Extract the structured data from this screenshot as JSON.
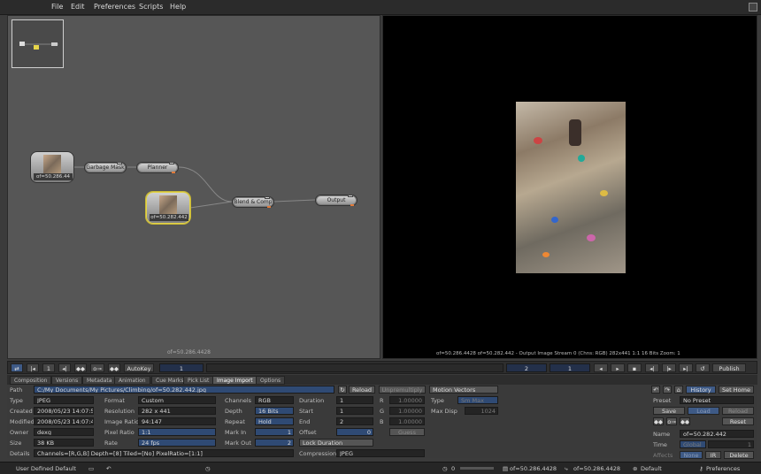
{
  "menu": {
    "file": "File",
    "edit": "Edit",
    "preferences": "Preferences",
    "scripts": "Scripts",
    "help": "Help"
  },
  "graph": {
    "label": "of=50.286.4428",
    "nodes": {
      "read1": "of=50.286.44",
      "garbage": "Garbage Mask",
      "planner": "Planner",
      "read2": "of=50.282.442",
      "blend": "Blend & Comp",
      "output": "Output"
    }
  },
  "viewer": {
    "status": "of=50.286.4428  of=50.282.442 - Output Image  Stream 0 (Chns: RGB)  282x441  1:1  16 Bits  Zoom: 1"
  },
  "toolbar": {
    "autokey": "AutoKey",
    "frame1": "1",
    "frame2": "1",
    "frame_field": "1",
    "frame_a": "2",
    "frame_b": "1",
    "publish": "Publish"
  },
  "tabs": [
    "Composition",
    "Versions",
    "Metadata",
    "Animation",
    "Cue Marks",
    "Pick List",
    "Image Import",
    "Options"
  ],
  "fields": {
    "path_label": "Path",
    "path": "C:/My Documents/My Pictures/Climbing/of=50.282.442.jpg",
    "reload": "Reload",
    "unpremultiply": "Unpremultiply",
    "motion_vectors": "Motion Vectors",
    "type_label": "Type",
    "type": "JPEG",
    "format_label": "Format",
    "format": "Custom",
    "channels_label": "Channels",
    "channels": "RGB",
    "duration_label": "Duration",
    "duration": "1",
    "r_label": "R",
    "r": "1.00000",
    "mv_type_label": "Type",
    "mv_type": "Sm Max",
    "created_label": "Created",
    "created": "2008/05/23 14:07:50",
    "resolution_label": "Resolution",
    "resolution": "282 x 441",
    "depth_label": "Depth",
    "depth": "16 Bits",
    "start_label": "Start",
    "start": "1",
    "g_label": "G",
    "g": "1.00000",
    "maxdisp_label": "Max Disp",
    "maxdisp": "1024",
    "modified_label": "Modified",
    "modified": "2008/05/23 14:07:47",
    "imageratio_label": "Image Ratio",
    "imageratio": "94:147",
    "repeat_label": "Repeat",
    "repeat": "Hold",
    "end_label": "End",
    "end": "2",
    "b_label": "B",
    "b": "1.00000",
    "owner_label": "Owner",
    "owner": "dexg",
    "pixelratio_label": "Pixel Ratio",
    "pixelratio": "1:1",
    "markin_label": "Mark In",
    "markin": "1",
    "offset_label": "Offset",
    "offset": "0",
    "guess": "Guess",
    "size_label": "Size",
    "size": "38 KB",
    "rate_label": "Rate",
    "rate": "24 fps",
    "markout_label": "Mark Out",
    "markout": "2",
    "lock_duration": "Lock Duration",
    "details_label": "Details",
    "details": "Channels=[R,G,B] Depth=[8] Tiled=[No] PixelRatio=[1:1]",
    "compression_label": "Compression",
    "compression": "JPEG"
  },
  "right": {
    "history": "History",
    "sethome": "Set Home",
    "preset_label": "Preset",
    "preset": "No Preset",
    "save": "Save",
    "load": "Load",
    "reload": "Reload",
    "reset": "Reset",
    "name_label": "Name",
    "name": "of=50.282.442",
    "time_label": "Time",
    "time": "Global",
    "time_val": "1",
    "affects_label": "Affects",
    "none": "None",
    "ir": "IR",
    "delete": "Delete"
  },
  "status": {
    "mode": "User Defined Default",
    "counter": "0",
    "file1": "of=50.286.4428",
    "file2": "of=50.286.4428",
    "default": "Default",
    "preferences": "Preferences"
  }
}
